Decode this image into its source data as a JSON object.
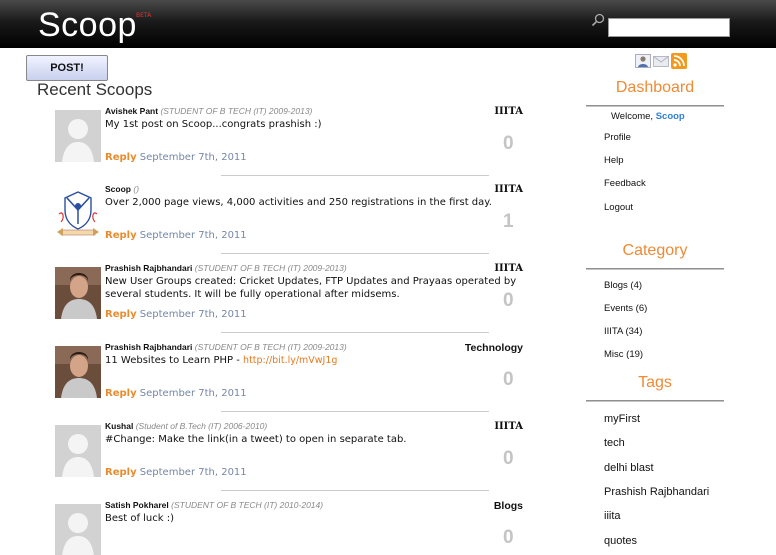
{
  "header": {
    "logo": "Scoop",
    "logo_badge": "BETA",
    "search_placeholder": ""
  },
  "actions": {
    "post_label": "POST!"
  },
  "feed": {
    "title": "Recent Scoops",
    "posts": [
      {
        "author": "Avishek Pant",
        "meta": "(STUDENT OF B TECH (IT) 2009-2013)",
        "category": "IIITA",
        "text": "My 1st post on Scoop...congrats prashish :)",
        "link": "",
        "reply": "Reply",
        "date": "September 7th, 2011",
        "count": "0",
        "avatar": "default-avatar-icon"
      },
      {
        "author": "Scoop",
        "meta": "()",
        "category": "IIITA",
        "text": "Over 2,000 page views, 4,000 activities and 250 registrations in the first day.",
        "link": "",
        "reply": "Reply",
        "date": "September 7th, 2011",
        "count": "1",
        "avatar": "iiita-emblem-icon"
      },
      {
        "author": "Prashish Rajbhandari",
        "meta": "(STUDENT OF B TECH (IT) 2009-2013)",
        "category": "IIITA",
        "text": "New User Groups created: Cricket Updates, FTP Updates and Prayaas operated by several students. It will be fully operational after midsems.",
        "link": "",
        "reply": "Reply",
        "date": "September 7th, 2011",
        "count": "0",
        "avatar": "user-photo"
      },
      {
        "author": "Prashish Rajbhandari",
        "meta": "(STUDENT OF B TECH (IT) 2009-2013)",
        "category": "Technology",
        "text": "11 Websites to Learn PHP - ",
        "link": "http://bit.ly/mVwJ1g",
        "reply": "Reply",
        "date": "September 7th, 2011",
        "count": "0",
        "avatar": "user-photo"
      },
      {
        "author": "Kushal",
        "meta": "(Student of B.Tech (IT) 2006-2010)",
        "category": "IIITA",
        "text": "#Change: Make the link(in a tweet) to open in separate tab.",
        "link": "",
        "reply": "Reply",
        "date": "September 7th, 2011",
        "count": "0",
        "avatar": "default-avatar-icon"
      },
      {
        "author": "Satish Pokharel",
        "meta": "(STUDENT OF B TECH (IT) 2010-2014)",
        "category": "Blogs",
        "text": "Best of luck :)",
        "link": "",
        "reply": "",
        "date": "",
        "count": "0",
        "avatar": "default-avatar-icon"
      }
    ]
  },
  "sidebar": {
    "icons": [
      "user-icon",
      "mail-icon",
      "rss-icon"
    ],
    "dashboard": {
      "title": "Dashboard",
      "welcome": "Welcome, ",
      "username": "Scoop",
      "links": [
        "Profile",
        "Help",
        "Feedback",
        "Logout"
      ]
    },
    "category": {
      "title": "Category",
      "items": [
        "Blogs (4)",
        "Events (6)",
        "IIITA (34)",
        "Misc (19)"
      ]
    },
    "tags": {
      "title": "Tags",
      "items": [
        "myFirst",
        "tech",
        "delhi blast",
        "Prashish Rajbhandari",
        "iiita",
        "quotes"
      ]
    }
  },
  "colors": {
    "accent": "#f08a34",
    "reply": "#e88b2e",
    "date": "#7587a6",
    "username": "#2f7fd3"
  }
}
